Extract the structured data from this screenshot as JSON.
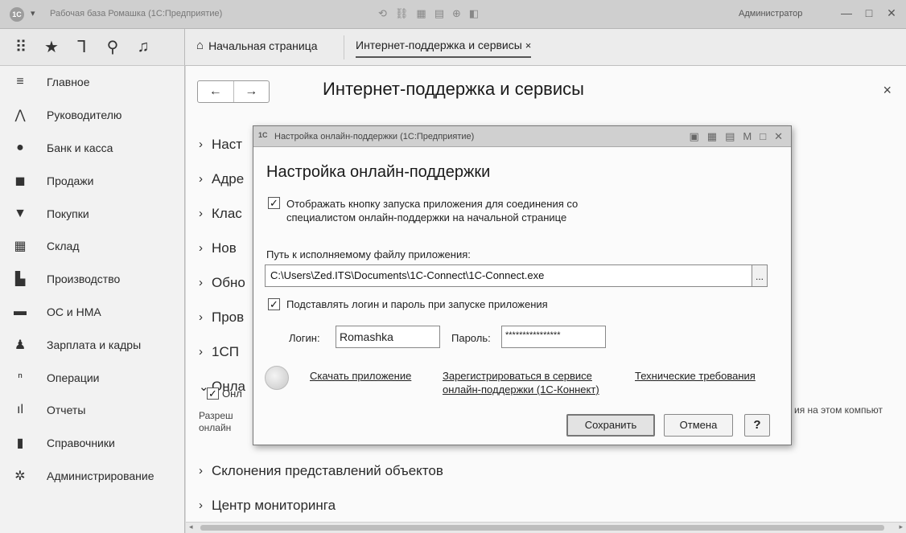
{
  "window": {
    "logo": "1С",
    "title": "Рабочая база Ромашка (1С:Предприятие)",
    "user": "Администратор",
    "buttons": [
      "—",
      "□",
      "✕"
    ]
  },
  "toolbar_icons": [
    "grid-menu-icon",
    "star-icon",
    "history-icon",
    "search-icon",
    "bell-icon"
  ],
  "tabs": {
    "home_label": "Начальная страница",
    "active_label": "Интернет-поддержка и сервисы",
    "close_glyph": "×"
  },
  "sidebar": {
    "items": [
      {
        "label": "Главное",
        "icon": "menu-lines-icon"
      },
      {
        "label": "Руководителю",
        "icon": "chart-trend-icon"
      },
      {
        "label": "Банк и касса",
        "icon": "coin-icon"
      },
      {
        "label": "Продажи",
        "icon": "bag-icon"
      },
      {
        "label": "Покупки",
        "icon": "cart-icon"
      },
      {
        "label": "Склад",
        "icon": "warehouse-icon"
      },
      {
        "label": "Производство",
        "icon": "factory-icon"
      },
      {
        "label": "ОС и НМА",
        "icon": "truck-icon"
      },
      {
        "label": "Зарплата и кадры",
        "icon": "person-icon"
      },
      {
        "label": "Операции",
        "icon": "operations-icon"
      },
      {
        "label": "Отчеты",
        "icon": "bar-chart-icon"
      },
      {
        "label": "Справочники",
        "icon": "book-icon"
      },
      {
        "label": "Администрирование",
        "icon": "gear-icon"
      }
    ]
  },
  "main": {
    "title": "Интернет-поддержка и сервисы",
    "close_glyph": "×",
    "nav_back": "←",
    "nav_forward": "→",
    "sections": [
      {
        "label": "Наст"
      },
      {
        "label": "Адре"
      },
      {
        "label": "Клас"
      },
      {
        "label": "Нов"
      },
      {
        "label": "Обно"
      },
      {
        "label": "Пров"
      },
      {
        "label": "1СП"
      },
      {
        "label": "Онла"
      }
    ],
    "expanded_checkbox_label": "Онл",
    "expanded_note": "Разреш\nонлайн",
    "right_note": "ия на этом компьют",
    "bottom_sections": [
      {
        "label": "Склонения представлений объектов"
      },
      {
        "label": "Центр мониторинга"
      }
    ]
  },
  "dialog": {
    "window_title": "Настройка онлайн-поддержки  (1С:Предприятие)",
    "heading": "Настройка онлайн-поддержки",
    "show_button_checkbox": {
      "checked": true,
      "label": "Отображать кнопку запуска приложения для соединения со специалистом онлайн-поддержки на начальной странице"
    },
    "path_label": "Путь к исполняемому файлу приложения:",
    "path_value": "C:\\Users\\Zed.ITS\\Documents\\1C-Connect\\1C-Connect.exe",
    "path_button": "...",
    "auth_checkbox": {
      "checked": true,
      "label": "Подставлять логин и пароль при запуске приложения"
    },
    "login_label": "Логин:",
    "login_value": "Romashka",
    "password_label": "Пароль:",
    "password_value": "****************",
    "links": {
      "download": "Скачать приложение",
      "register_line1": "Зарегистрироваться в сервисе",
      "register_line2": "онлайн-поддержки (1С-Коннект)",
      "tech": "Технические требования"
    },
    "buttons": {
      "save": "Сохранить",
      "cancel": "Отмена",
      "help": "?"
    }
  }
}
